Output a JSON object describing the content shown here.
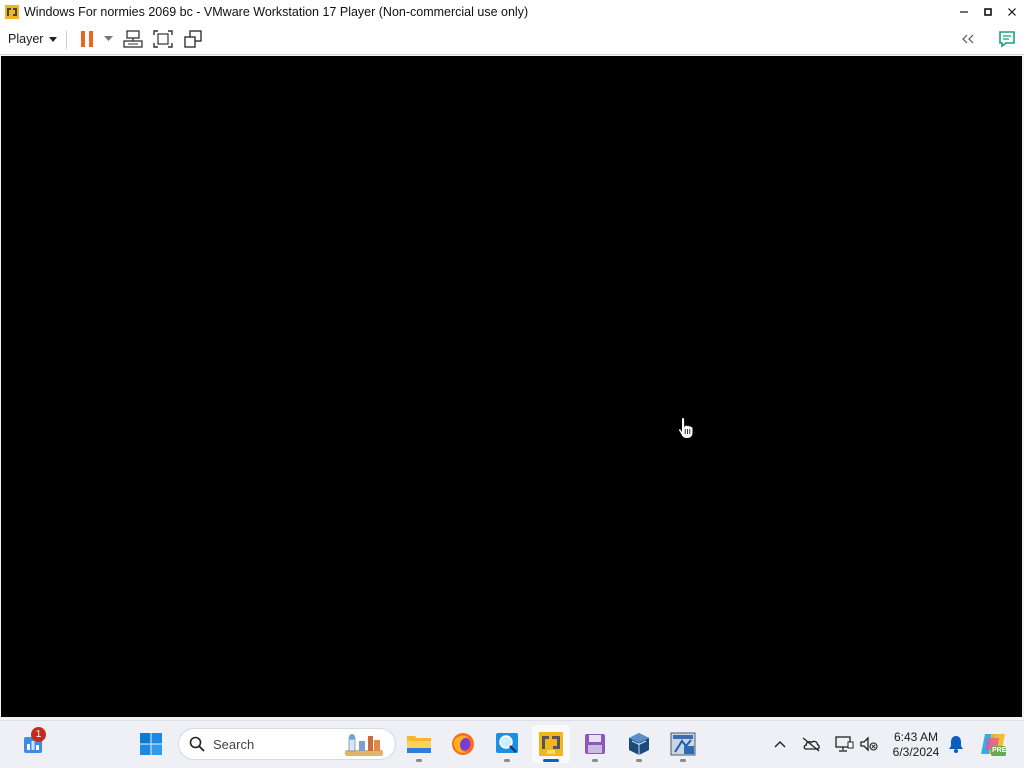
{
  "window": {
    "title": "Windows For normies 2069 bc - VMware Workstation 17 Player (Non-commercial use only)",
    "icons": {
      "app": "vmware-player-icon",
      "minimize": "minimize-icon",
      "maximize": "maximize-icon",
      "close": "close-icon"
    }
  },
  "toolbar": {
    "player_menu_label": "Player",
    "buttons": [
      {
        "name": "pause-vm",
        "icon": "pause-icon"
      },
      {
        "name": "pause-options",
        "icon": "chevron-down-icon"
      },
      {
        "name": "send-ctrl-alt-del",
        "icon": "send-keys-icon"
      },
      {
        "name": "full-screen",
        "icon": "fullscreen-icon"
      },
      {
        "name": "unity",
        "icon": "unity-icon"
      },
      {
        "name": "collapse-toolbar",
        "icon": "double-chevron-left-icon"
      },
      {
        "name": "message-log",
        "icon": "message-log-icon"
      }
    ],
    "colors": {
      "pause": "#e8661d",
      "accent": "#1aa37a"
    }
  },
  "vm_display": {
    "background": "#000000"
  },
  "taskbar": {
    "widgets_badge": "1",
    "search_placeholder": "Search",
    "apps": [
      {
        "name": "widgets",
        "icon": "widgets-icon"
      },
      {
        "name": "start",
        "icon": "windows-start-icon"
      },
      {
        "name": "file-explorer",
        "icon": "folder-icon",
        "running": true
      },
      {
        "name": "firefox",
        "icon": "firefox-icon",
        "running": false
      },
      {
        "name": "magnifier",
        "icon": "magnifier-icon",
        "running": true
      },
      {
        "name": "vmware-player",
        "icon": "vmware-player-icon",
        "running": true,
        "active": true
      },
      {
        "name": "floppy-app",
        "icon": "floppy-disk-icon",
        "running": true
      },
      {
        "name": "virtualbox",
        "icon": "virtualbox-icon",
        "running": true
      },
      {
        "name": "windows-10-installer",
        "icon": "windows-10-installer-icon",
        "running": true
      }
    ],
    "tray": {
      "icons": [
        "chevron-up-icon",
        "onedrive-icon",
        "network-icon",
        "volume-muted-icon"
      ],
      "time": "6:43 AM",
      "date": "6/3/2024",
      "notification_icon": "bell-icon",
      "copilot_icon": "copilot-pre-icon",
      "copilot_label": "PRE"
    }
  }
}
